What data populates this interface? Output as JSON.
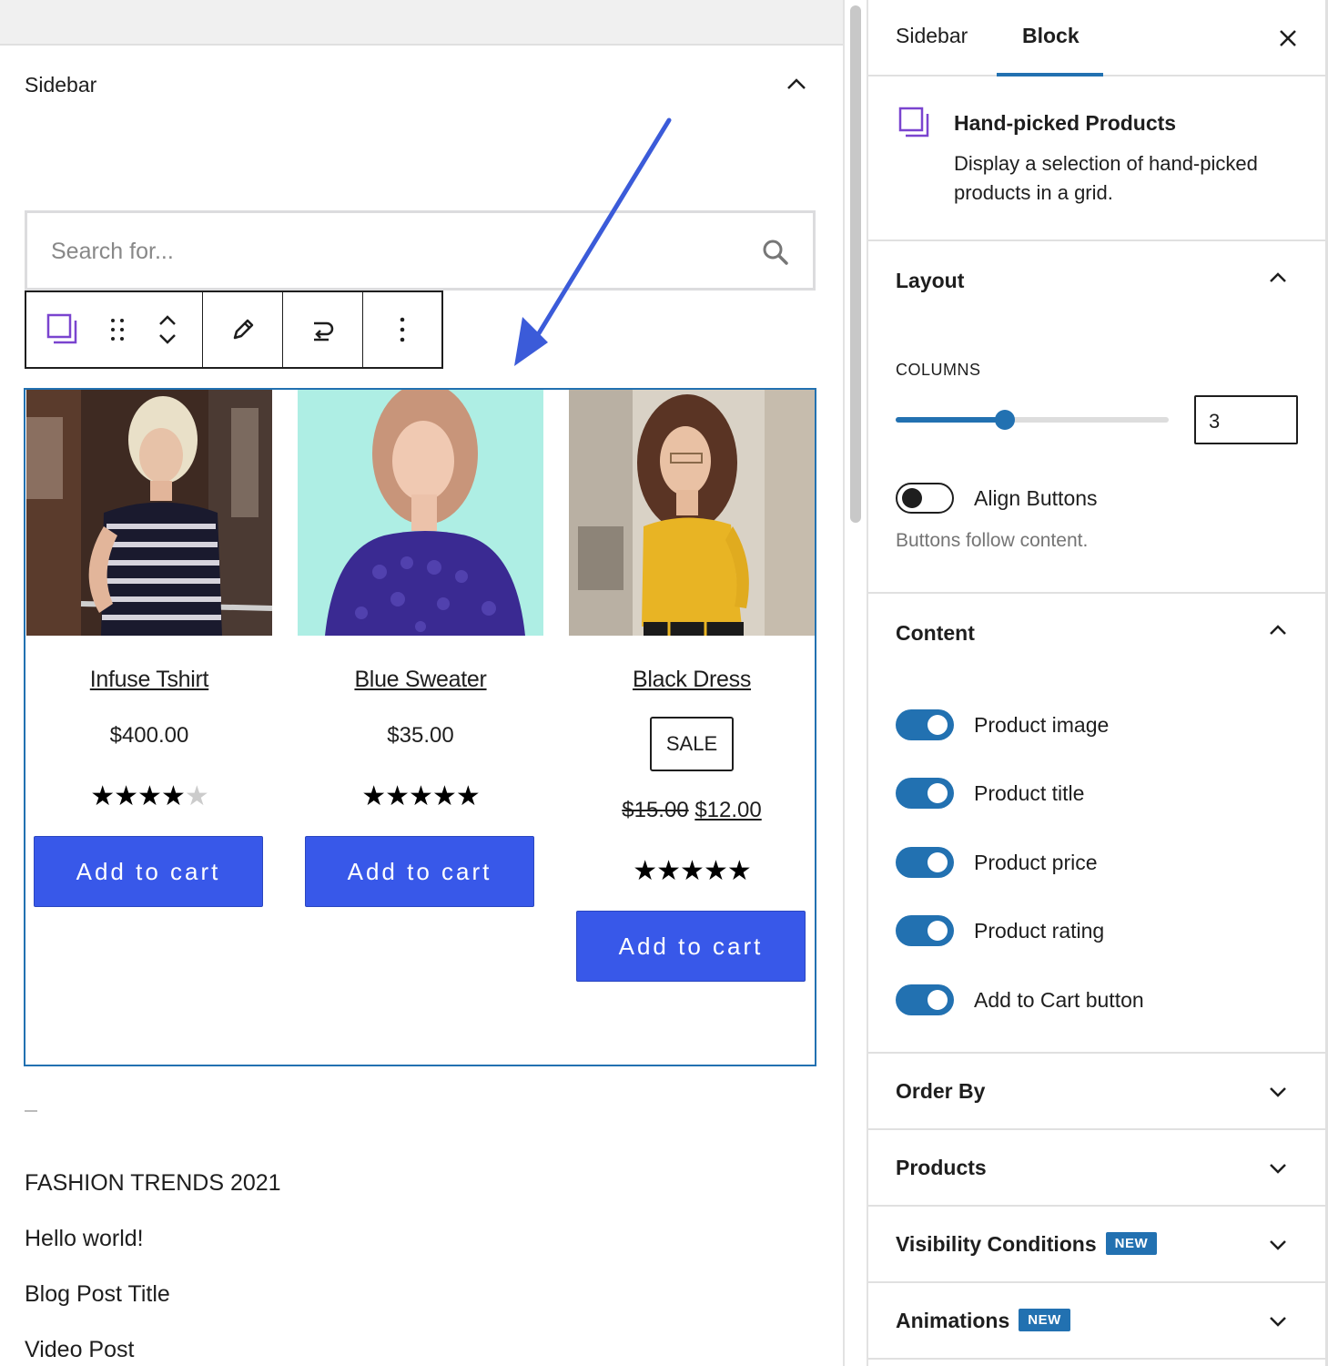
{
  "editor": {
    "section_title": "Sidebar",
    "search": {
      "placeholder": "Search for..."
    },
    "products": [
      {
        "title": "Infuse Tshirt",
        "price": "$400.00",
        "rating": 4,
        "button": "Add to cart"
      },
      {
        "title": "Blue Sweater",
        "price": "$35.00",
        "rating": 5,
        "button": "Add to cart"
      },
      {
        "title": "Black Dress",
        "sale_badge": "SALE",
        "old_price": "$15.00",
        "price": "$12.00",
        "rating": 5,
        "button": "Add to cart"
      }
    ],
    "post_links": [
      "FASHION TRENDS 2021",
      "Hello world!",
      "Blog Post Title",
      "Video Post"
    ]
  },
  "settings": {
    "tabs": [
      "Sidebar",
      "Block"
    ],
    "active_tab": "Block",
    "block_card": {
      "title": "Hand-picked Products",
      "description": "Display a selection of hand-picked products in a grid."
    },
    "layout": {
      "title": "Layout",
      "columns_label": "COLUMNS",
      "columns_value": "3",
      "columns_slider_fraction": 0.4,
      "align_buttons_label": "Align Buttons",
      "align_buttons_on": false,
      "align_buttons_help": "Buttons follow content."
    },
    "content": {
      "title": "Content",
      "toggles": [
        {
          "label": "Product image",
          "on": true
        },
        {
          "label": "Product title",
          "on": true
        },
        {
          "label": "Product price",
          "on": true
        },
        {
          "label": "Product rating",
          "on": true
        },
        {
          "label": "Add to Cart button",
          "on": true
        }
      ]
    },
    "collapsed_panels": [
      {
        "title": "Order By",
        "badge": ""
      },
      {
        "title": "Products",
        "badge": ""
      },
      {
        "title": "Visibility Conditions",
        "badge": "NEW"
      },
      {
        "title": "Animations",
        "badge": "NEW"
      }
    ]
  },
  "colors": {
    "accent": "#2271b1",
    "button": "#3858e9",
    "arrow": "#3b5bd9"
  }
}
